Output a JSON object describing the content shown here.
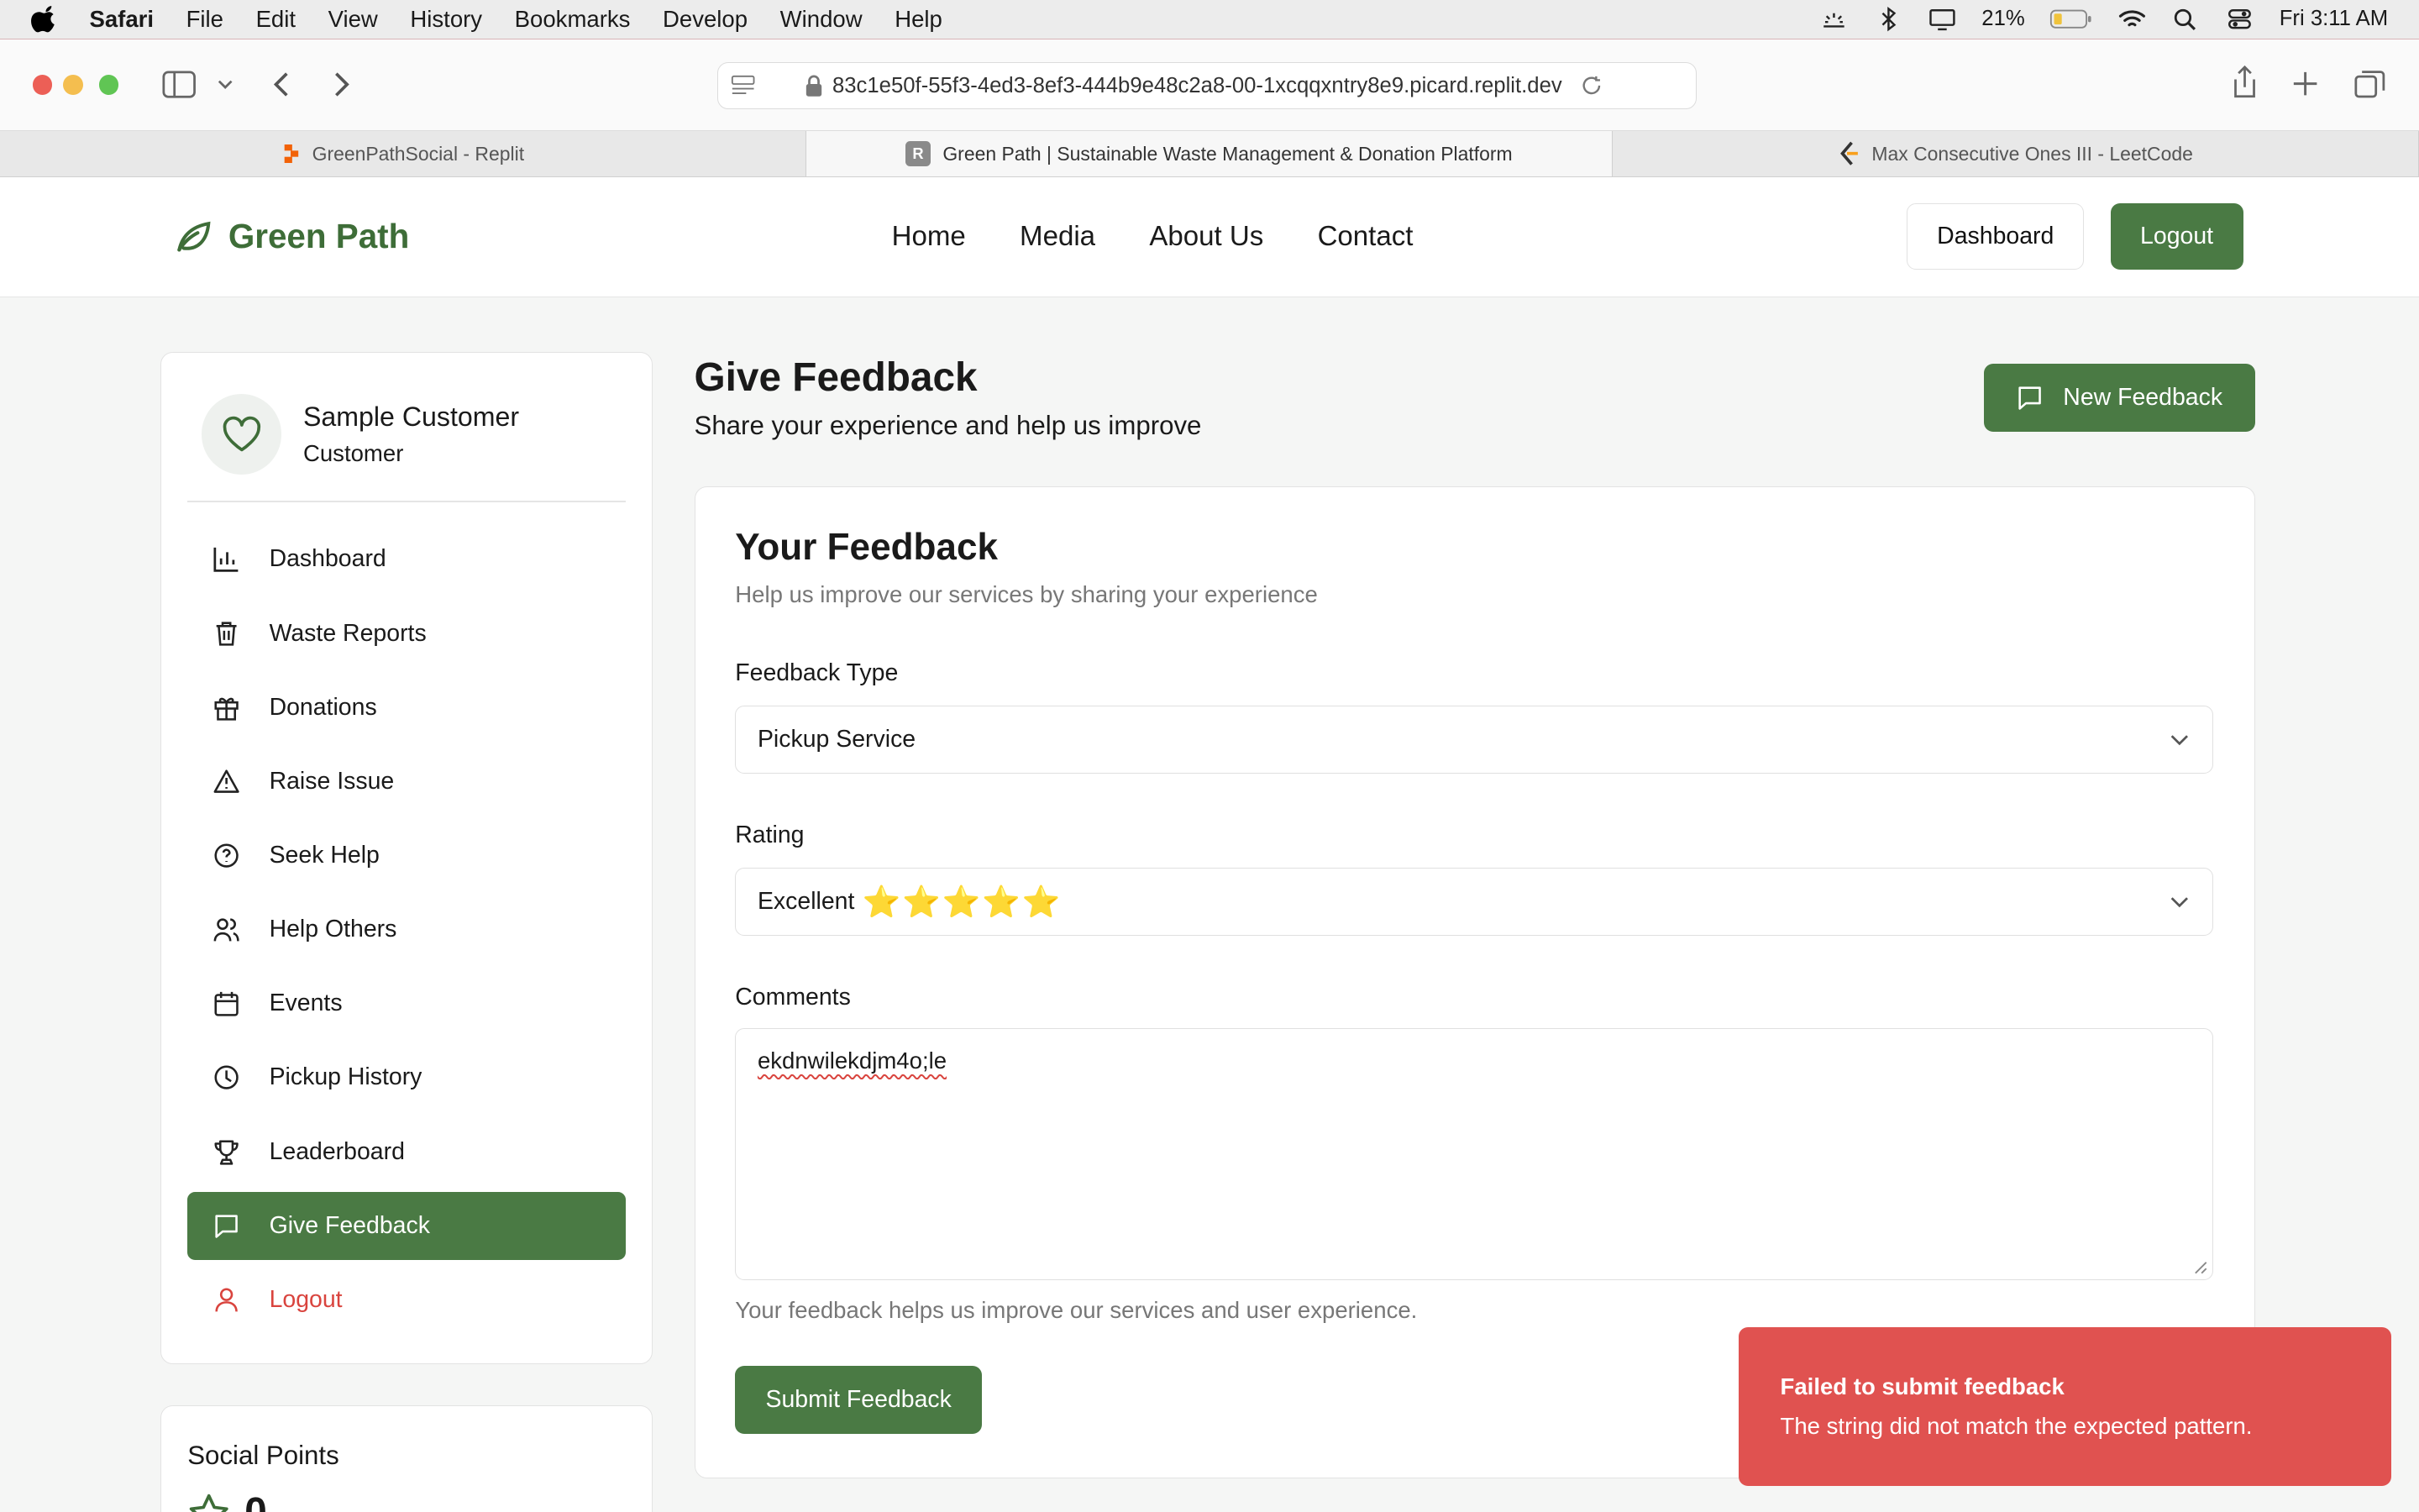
{
  "menubar": {
    "app": "Safari",
    "items": [
      "File",
      "Edit",
      "View",
      "History",
      "Bookmarks",
      "Develop",
      "Window",
      "Help"
    ],
    "battery": "21%",
    "clock": "Fri 3:11 AM"
  },
  "browser": {
    "url": "83c1e50f-55f3-4ed3-8ef3-444b9e48c2a8-00-1xcqqxntry8e9.picard.replit.dev",
    "tabs": [
      {
        "label": "GreenPathSocial - Replit"
      },
      {
        "label": "Green Path | Sustainable Waste Management & Donation Platform"
      },
      {
        "label": "Max Consecutive Ones III - LeetCode"
      }
    ]
  },
  "site": {
    "brand": "Green Path",
    "nav": [
      "Home",
      "Media",
      "About Us",
      "Contact"
    ],
    "dashboard_btn": "Dashboard",
    "logout_btn": "Logout"
  },
  "sidebar": {
    "name": "Sample Customer",
    "role": "Customer",
    "items": [
      {
        "label": "Dashboard",
        "icon": "bar-chart-icon"
      },
      {
        "label": "Waste Reports",
        "icon": "trash-icon"
      },
      {
        "label": "Donations",
        "icon": "gift-icon"
      },
      {
        "label": "Raise Issue",
        "icon": "warning-icon"
      },
      {
        "label": "Seek Help",
        "icon": "help-circle-icon"
      },
      {
        "label": "Help Others",
        "icon": "users-icon"
      },
      {
        "label": "Events",
        "icon": "calendar-icon"
      },
      {
        "label": "Pickup History",
        "icon": "clock-icon"
      },
      {
        "label": "Leaderboard",
        "icon": "trophy-icon"
      },
      {
        "label": "Give Feedback",
        "icon": "message-icon"
      },
      {
        "label": "Logout",
        "icon": "user-icon"
      }
    ],
    "points_title": "Social Points",
    "points_value": "0"
  },
  "page": {
    "title": "Give Feedback",
    "subtitle": "Share your experience and help us improve",
    "new_btn": "New Feedback"
  },
  "form": {
    "title": "Your Feedback",
    "desc": "Help us improve our services by sharing your experience",
    "type_label": "Feedback Type",
    "type_value": "Pickup Service",
    "rating_label": "Rating",
    "rating_value": "Excellent",
    "rating_stars": 5,
    "comments_label": "Comments",
    "comments_value": "ekdnwilekdjm4o;le",
    "hint": "Your feedback helps us improve our services and user experience.",
    "submit": "Submit Feedback"
  },
  "toast": {
    "title": "Failed to submit feedback",
    "message": "The string did not match the expected pattern."
  },
  "colors": {
    "brand_green": "#4a7a44",
    "error_red": "#e05250"
  }
}
